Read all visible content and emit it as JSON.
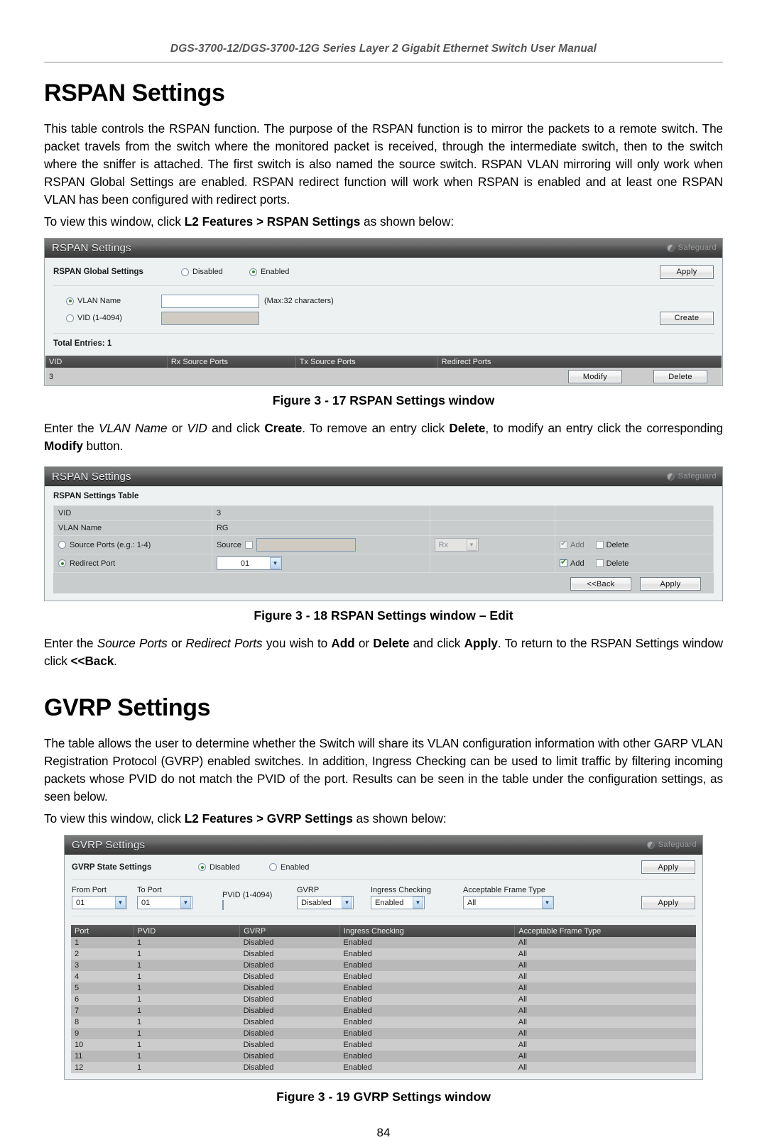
{
  "running_header": "DGS-3700-12/DGS-3700-12G Series Layer 2 Gigabit Ethernet Switch User Manual",
  "page_number": "84",
  "sections": {
    "rspan": {
      "heading": "RSPAN Settings",
      "intro": "This table controls the RSPAN function. The purpose of the RSPAN function is to mirror the packets to a remote switch. The packet travels from the switch where the monitored packet is received, through the intermediate switch, then to the switch where the sniffer is attached. The first switch is also named the source switch. RSPAN VLAN mirroring will only work when RSPAN Global Settings are enabled. RSPAN redirect function will work when RSPAN is enabled and at least one RSPAN VLAN has been configured with redirect ports.",
      "nav_prefix": "To view this window, click ",
      "nav_path": "L2 Features > RSPAN Settings",
      "nav_suffix": " as shown below:",
      "caption_fig17": "Figure 3 - 17 RSPAN Settings window",
      "after_fig17": {
        "t1": "Enter the ",
        "i1": "VLAN Name",
        "t2": " or ",
        "i2": "VID",
        "t3": " and click ",
        "b1": "Create",
        "t4": ". To remove an entry click ",
        "b2": "Delete",
        "t5": ", to modify an entry click the corresponding ",
        "b3": "Modify",
        "t6": " button."
      },
      "caption_fig18": "Figure 3 - 18 RSPAN Settings window – Edit",
      "after_fig18": {
        "t1": "Enter the ",
        "i1": "Source Ports",
        "t2": " or ",
        "i2": "Redirect Ports",
        "t3": " you wish to ",
        "b1": "Add",
        "t4": " or ",
        "b2": "Delete",
        "t5": " and click ",
        "b3": "Apply",
        "t6": ". To return to the RSPAN Settings window click ",
        "b4": "<<Back",
        "t7": "."
      }
    },
    "gvrp": {
      "heading": "GVRP Settings",
      "intro": "The table allows the user to determine whether the Switch will share its VLAN configuration information with other GARP VLAN Registration Protocol (GVRP) enabled switches. In addition, Ingress Checking can be used to limit traffic by filtering incoming packets whose PVID do not match the PVID of the port. Results can be seen in the table under the configuration settings, as seen below.",
      "nav_prefix": "To view this window, click ",
      "nav_path": "L2 Features > GVRP Settings",
      "nav_suffix": " as shown below:",
      "caption_fig19": "Figure 3 - 19 GVRP Settings window"
    }
  },
  "fig17": {
    "window_title": "RSPAN Settings",
    "safeguard": "Safeguard",
    "global_label": "RSPAN Global Settings",
    "opt_disabled": "Disabled",
    "opt_enabled": "Enabled",
    "global_selected": "Enabled",
    "apply_label": "Apply",
    "vlan_name_label": "VLAN Name",
    "vlan_name_value": "",
    "vlan_name_hint": "(Max:32 characters)",
    "vid_label": "VID (1-4094)",
    "vid_value": "",
    "create_label": "Create",
    "total_entries": "Total Entries: 1",
    "columns": [
      "VID",
      "Rx Source Ports",
      "Tx Source Ports",
      "Redirect Ports"
    ],
    "rows": [
      {
        "vid": "3",
        "rx": "",
        "tx": "",
        "redirect": ""
      }
    ],
    "modify_label": "Modify",
    "delete_label": "Delete"
  },
  "fig18": {
    "window_title": "RSPAN Settings",
    "safeguard": "Safeguard",
    "table_title": "RSPAN Settings Table",
    "vid_label": "VID",
    "vid_value": "3",
    "vlan_name_label": "VLAN Name",
    "vlan_name_value": "RG",
    "source_ports_label": "Source Ports (e.g.: 1-4)",
    "source_prefix": "Source",
    "source_value": "",
    "direction_value": "Rx",
    "redirect_port_label": "Redirect Port",
    "redirect_port_value": "01",
    "add_label": "Add",
    "delete_label": "Delete",
    "back_label": "<<Back",
    "apply_label": "Apply"
  },
  "fig19": {
    "window_title": "GVRP Settings",
    "safeguard": "Safeguard",
    "state_label": "GVRP State Settings",
    "opt_disabled": "Disabled",
    "opt_enabled": "Enabled",
    "state_selected": "Disabled",
    "apply_top_label": "Apply",
    "apply_mid_label": "Apply",
    "fields": {
      "from_port_label": "From Port",
      "from_port_value": "01",
      "to_port_label": "To Port",
      "to_port_value": "01",
      "pvid_label": "PVID (1-4094)",
      "pvid_value": "",
      "gvrp_label": "GVRP",
      "gvrp_value": "Disabled",
      "ingress_label": "Ingress Checking",
      "ingress_value": "Enabled",
      "frame_label": "Acceptable Frame Type",
      "frame_value": "All"
    },
    "columns": [
      "Port",
      "PVID",
      "GVRP",
      "Ingress Checking",
      "Acceptable Frame Type"
    ],
    "rows": [
      [
        "1",
        "1",
        "Disabled",
        "Enabled",
        "All"
      ],
      [
        "2",
        "1",
        "Disabled",
        "Enabled",
        "All"
      ],
      [
        "3",
        "1",
        "Disabled",
        "Enabled",
        "All"
      ],
      [
        "4",
        "1",
        "Disabled",
        "Enabled",
        "All"
      ],
      [
        "5",
        "1",
        "Disabled",
        "Enabled",
        "All"
      ],
      [
        "6",
        "1",
        "Disabled",
        "Enabled",
        "All"
      ],
      [
        "7",
        "1",
        "Disabled",
        "Enabled",
        "All"
      ],
      [
        "8",
        "1",
        "Disabled",
        "Enabled",
        "All"
      ],
      [
        "9",
        "1",
        "Disabled",
        "Enabled",
        "All"
      ],
      [
        "10",
        "1",
        "Disabled",
        "Enabled",
        "All"
      ],
      [
        "11",
        "1",
        "Disabled",
        "Enabled",
        "All"
      ],
      [
        "12",
        "1",
        "Disabled",
        "Enabled",
        "All"
      ]
    ]
  }
}
